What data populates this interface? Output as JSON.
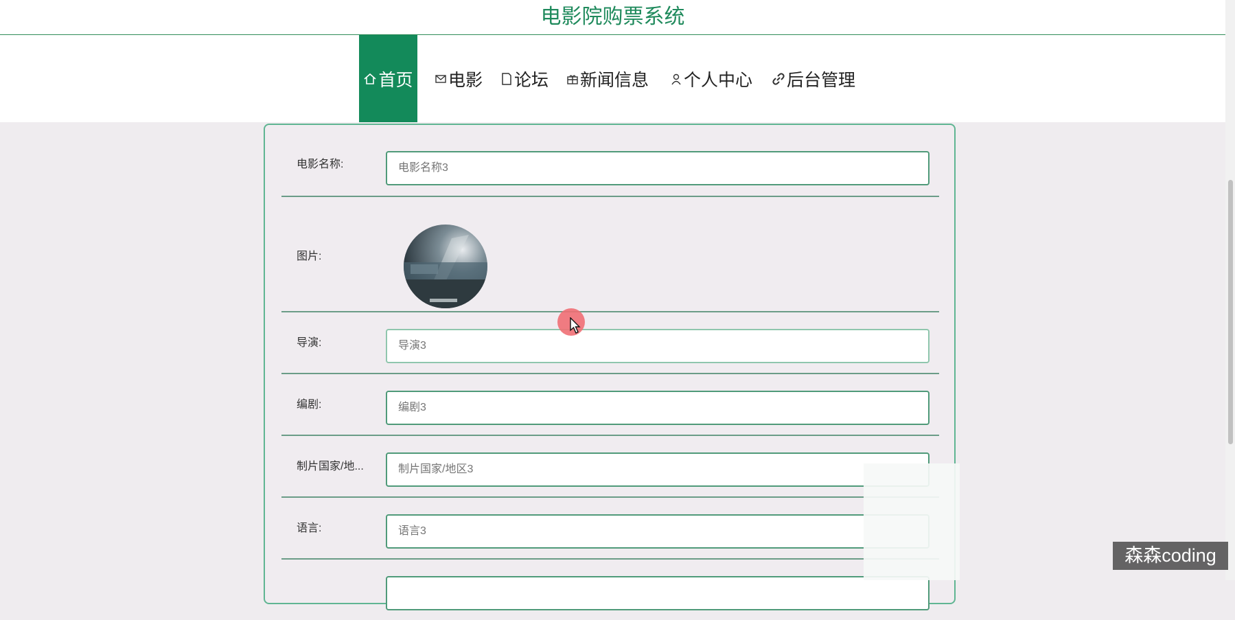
{
  "header": {
    "title": "电影院购票系统"
  },
  "nav": {
    "items": [
      {
        "label": "首页",
        "icon": "home-icon",
        "active": true
      },
      {
        "label": "电影",
        "icon": "mail-icon"
      },
      {
        "label": "论坛",
        "icon": "document-icon"
      },
      {
        "label": "新闻信息",
        "icon": "gift-icon"
      },
      {
        "label": "个人中心",
        "icon": "user-icon"
      },
      {
        "label": "后台管理",
        "icon": "link-icon"
      }
    ]
  },
  "form": {
    "movie_name": {
      "label": "电影名称:",
      "placeholder": "电影名称3"
    },
    "image": {
      "label": "图片:"
    },
    "director": {
      "label": "导演:",
      "placeholder": "导演3"
    },
    "screenwriter": {
      "label": "编剧:",
      "placeholder": "编剧3"
    },
    "country": {
      "label": "制片国家/地...",
      "placeholder": "制片国家/地区3"
    },
    "language": {
      "label": "语言:",
      "placeholder": "语言3"
    }
  },
  "watermark": "森森coding",
  "colors": {
    "accent": "#138a5a",
    "title": "#1f8a5c",
    "placeholder": "#7fb8e6"
  }
}
